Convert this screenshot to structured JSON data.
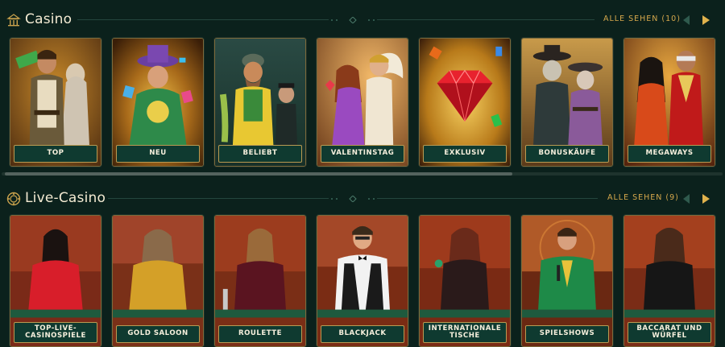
{
  "casino": {
    "title": "Casino",
    "see_all": "ALLE SEHEN (10)",
    "tiles": [
      {
        "label": "TOP",
        "icon": "adventurer-duo-art"
      },
      {
        "label": "NEU",
        "icon": "wizard-art"
      },
      {
        "label": "BELIEBT",
        "icon": "fisherman-art"
      },
      {
        "label": "VALENTINSTAG",
        "icon": "goddess-couple-art"
      },
      {
        "label": "EXKLUSIV",
        "icon": "ruby-gem-art"
      },
      {
        "label": "BONUSKÄUFE",
        "icon": "bandits-art"
      },
      {
        "label": "MEGAWAYS",
        "icon": "party-duo-art"
      }
    ]
  },
  "live": {
    "title": "Live-Casino",
    "see_all": "ALLE SEHEN (9)",
    "tiles": [
      {
        "label": "TOP-LIVE-CASINOSPIELE",
        "label_lines": [
          "TOP-LIVE-",
          "CASINOSPIELE"
        ],
        "icon": "dealer-red-dress-art"
      },
      {
        "label": "GOLD SALOON",
        "icon": "dealer-gold-dress-art"
      },
      {
        "label": "ROULETTE",
        "icon": "dealer-roulette-art"
      },
      {
        "label": "BLACKJACK",
        "icon": "dealer-blackjack-art"
      },
      {
        "label": "INTERNATIONALE TISCHE",
        "label_lines": [
          "INTERNATIONALE",
          "TISCHE"
        ],
        "icon": "dealer-international-art"
      },
      {
        "label": "SPIELSHOWS",
        "icon": "host-gameshow-art"
      },
      {
        "label": "BACCARAT UND WÜRFEL",
        "label_lines": [
          "BACCARAT UND",
          "WÜRFEL"
        ],
        "icon": "dealer-baccarat-art"
      }
    ]
  },
  "colors": {
    "background": "#0b211c",
    "accent_gold": "#d6a84c",
    "label_bg": "#0f3a30",
    "nav_active": "#e0b24c",
    "nav_inactive": "#2f5a4d"
  }
}
